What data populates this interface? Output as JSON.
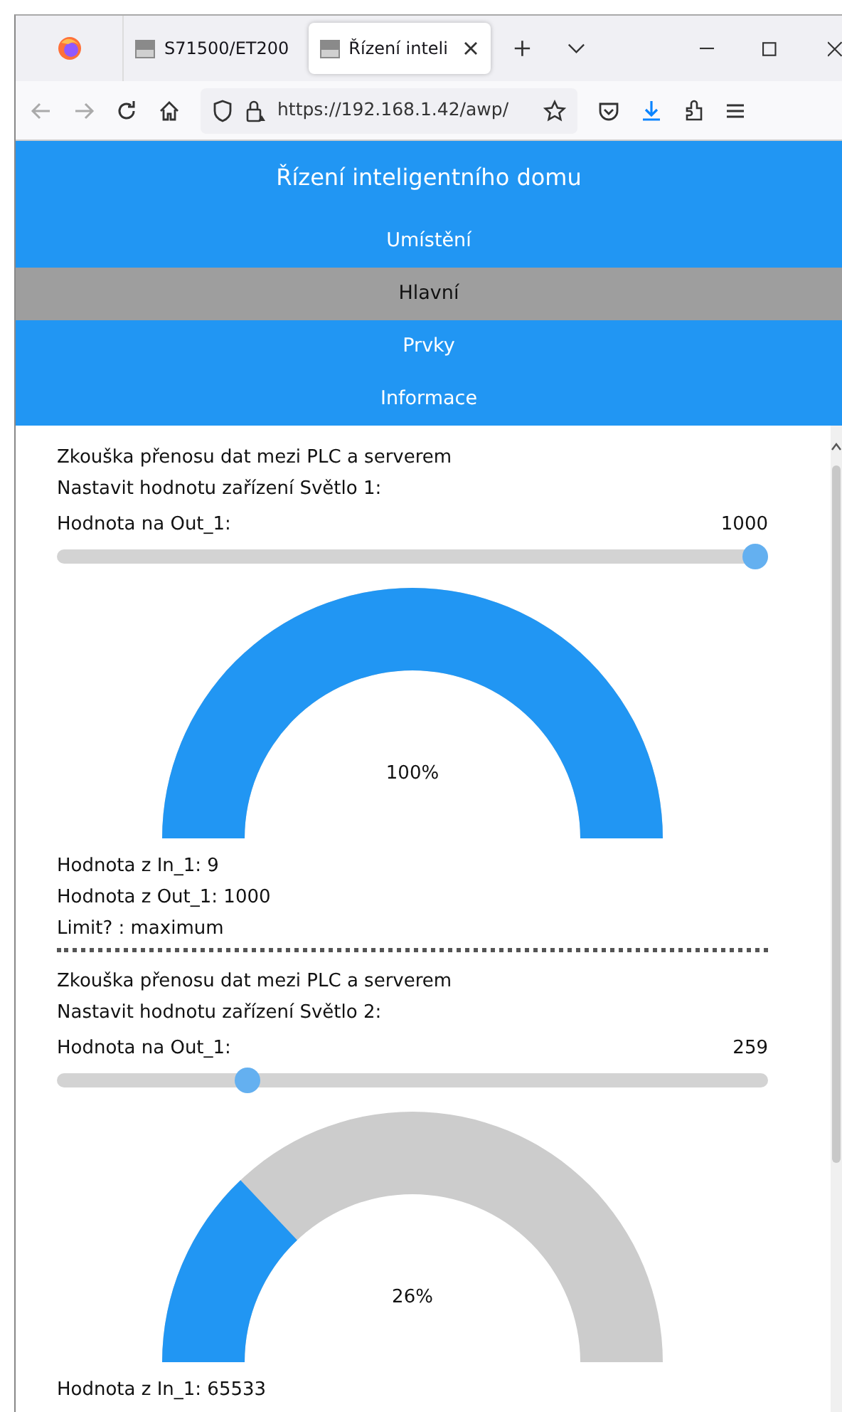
{
  "browser": {
    "tabs": [
      {
        "title": "S71500/ET200",
        "selected": false
      },
      {
        "title": "Řízení inteli",
        "selected": true
      }
    ],
    "url": "https://192.168.1.42/awp/"
  },
  "page": {
    "title": "Řízení inteligentního domu",
    "nav": [
      {
        "label": "Umístění",
        "selected": false
      },
      {
        "label": "Hlavní",
        "selected": true
      },
      {
        "label": "Prvky",
        "selected": false
      },
      {
        "label": "Informace",
        "selected": false
      }
    ]
  },
  "devices": [
    {
      "heading": "Zkouška přenosu dat mezi PLC a serverem",
      "setting": "Nastavit hodnotu zařízení Světlo 1:",
      "slider_label": "Hodnota na Out_1:",
      "slider_value": "1000",
      "slider": {
        "level": 1
      },
      "gauge": {
        "level": 1,
        "reading": "100%"
      },
      "readings": [
        "Hodnota z In_1: 9",
        "Hodnota z Out_1: 1000",
        "Limit? : maximum"
      ]
    },
    {
      "heading": "Zkouška přenosu dat mezi PLC a serverem",
      "setting": "Nastavit hodnotu zařízení Světlo 2:",
      "slider_label": "Hodnota na Out_1:",
      "slider_value": "259",
      "slider": {
        "level": 0.259
      },
      "gauge": {
        "level": 0.259,
        "reading": "26%"
      },
      "readings": [
        "Hodnota z In_1: 65533"
      ]
    }
  ]
}
